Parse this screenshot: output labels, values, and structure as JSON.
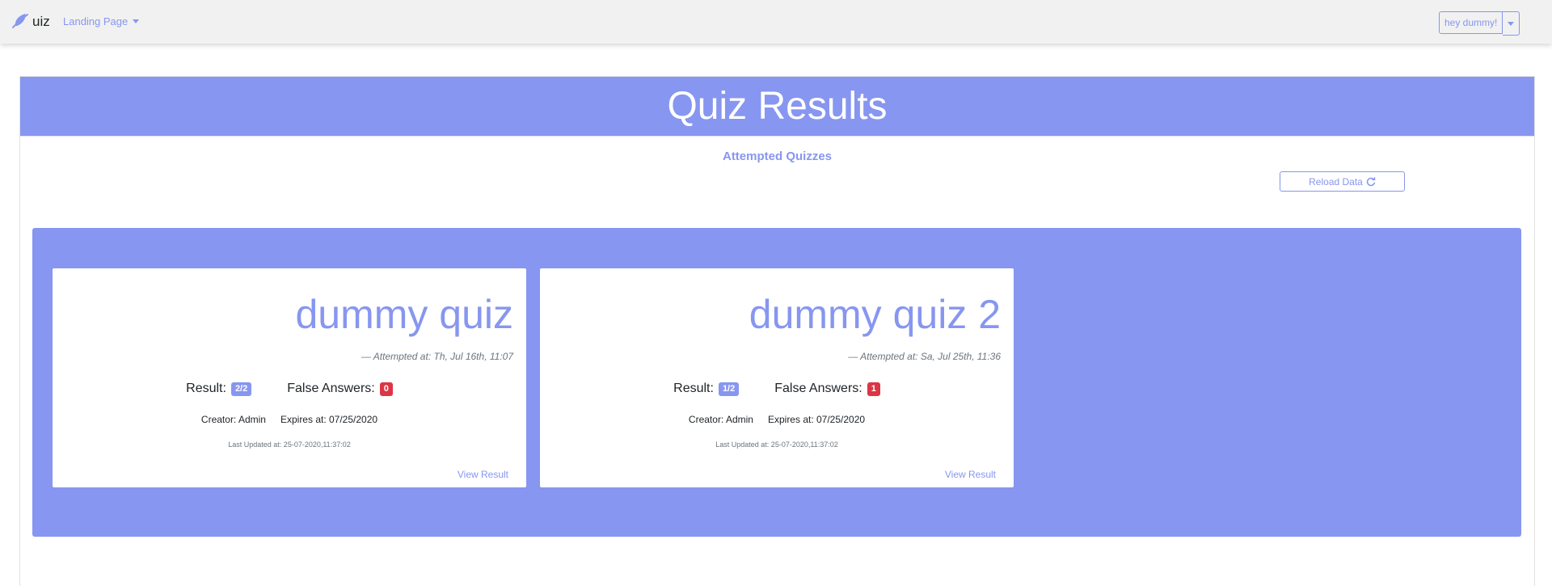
{
  "navbar": {
    "brand": "uiz",
    "landing_dropdown": "Landing Page",
    "user_button": "hey dummy!"
  },
  "colors": {
    "accent": "#8796f0",
    "success_badge": "#8796f0",
    "danger_badge": "#dc3545"
  },
  "page": {
    "title": "Quiz Results",
    "subheading": "Attempted Quizzes",
    "reload_label": "Reload Data"
  },
  "quizzes": [
    {
      "title": "dummy quiz",
      "attempted": "— Attempted at: Th, Jul 16th, 11:07",
      "result_label": "Result:",
      "result_value": "2/2",
      "false_label": "False Answers:",
      "false_value": "0",
      "creator": "Creator: Admin",
      "expires": "Expires at: 07/25/2020",
      "updated": "Last Updated at: 25-07-2020,11:37:02",
      "view_label": "View Result"
    },
    {
      "title": "dummy quiz 2",
      "attempted": "— Attempted at: Sa, Jul 25th, 11:36",
      "result_label": "Result:",
      "result_value": "1/2",
      "false_label": "False Answers:",
      "false_value": "1",
      "creator": "Creator: Admin",
      "expires": "Expires at: 07/25/2020",
      "updated": "Last Updated at: 25-07-2020,11:37:02",
      "view_label": "View Result"
    }
  ]
}
